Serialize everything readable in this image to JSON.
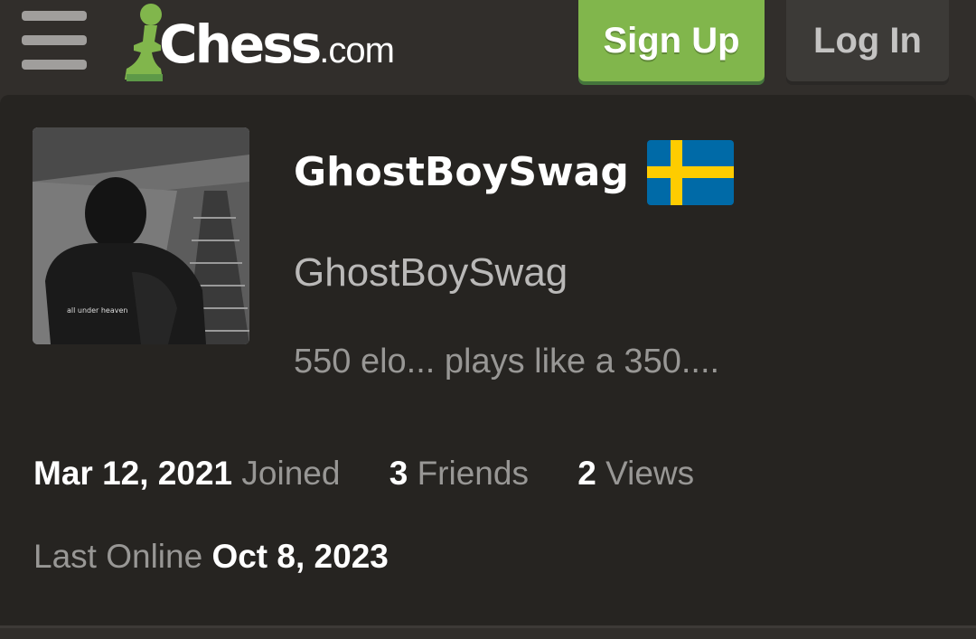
{
  "header": {
    "logo_main": "Chess",
    "logo_suffix": ".com",
    "signup_label": "Sign Up",
    "login_label": "Log In"
  },
  "profile": {
    "username": "GhostBoySwag",
    "display_name": "GhostBoySwag",
    "bio": "550 elo... plays like a 350....",
    "country_flag": "sweden-flag",
    "avatar_caption": "all under heaven"
  },
  "stats": {
    "joined_value": "Mar 12, 2021",
    "joined_label": "Joined",
    "friends_value": "3",
    "friends_label": "Friends",
    "views_value": "2",
    "views_label": "Views",
    "last_online_label": "Last Online",
    "last_online_value": "Oct 8, 2023"
  },
  "colors": {
    "background": "#312e2b",
    "card": "#262421",
    "accent_green": "#81b64c",
    "flag_blue": "#006aa7",
    "flag_yellow": "#fecc00"
  }
}
